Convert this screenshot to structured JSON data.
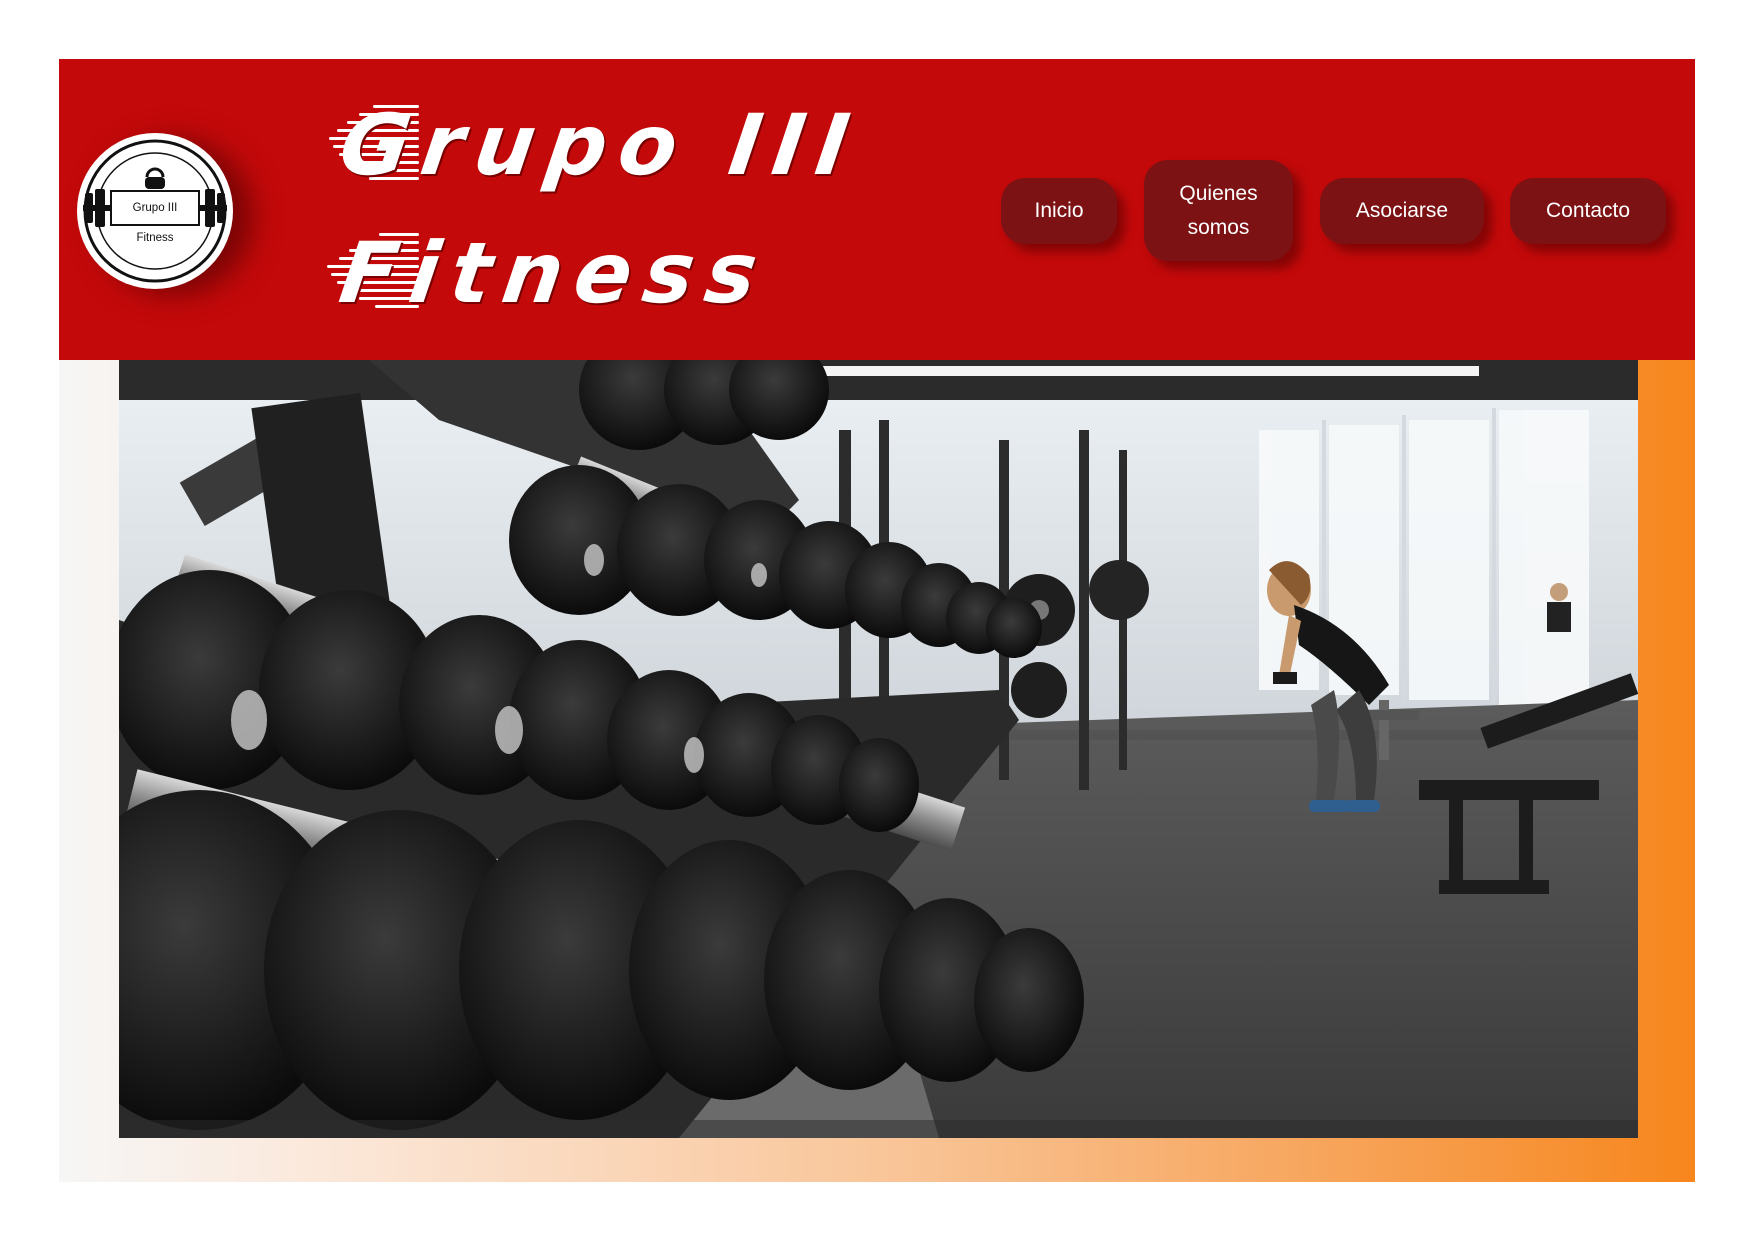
{
  "site": {
    "logo": {
      "line1": "Grupo III",
      "line2": "Fitness"
    },
    "brand": {
      "line1": "Grupo III",
      "line2": "Fitness"
    }
  },
  "nav": {
    "items": [
      {
        "label": "Inicio"
      },
      {
        "label": "Quienes\nsomos"
      },
      {
        "label": "Asociarse"
      },
      {
        "label": "Contacto"
      }
    ]
  },
  "hero": {
    "image": "gym-dumbbell-rack-photo"
  },
  "colors": {
    "header_red": "#c4090a",
    "nav_button": "#7c1214",
    "accent_orange": "#f7861c"
  }
}
